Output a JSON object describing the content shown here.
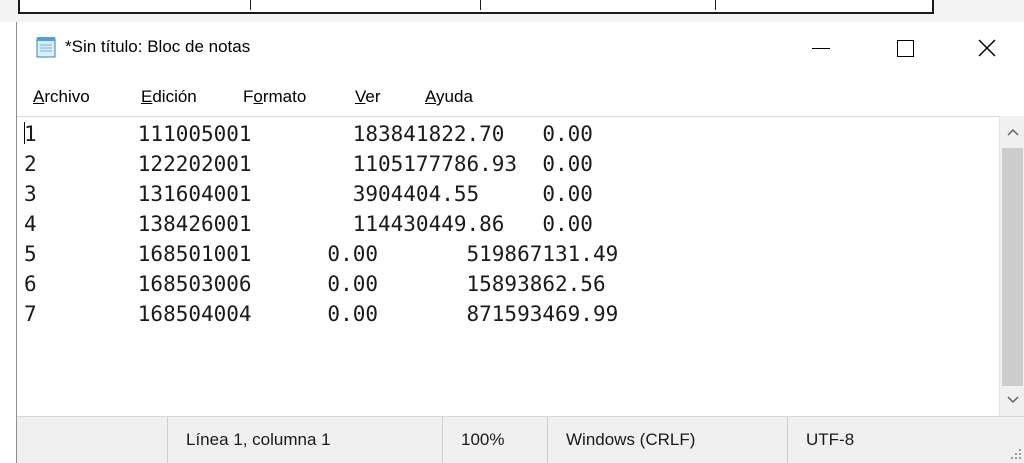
{
  "window": {
    "title": "*Sin título: Bloc de notas"
  },
  "menu": {
    "items": [
      {
        "label_ul": "A",
        "label_rest": "rchivo"
      },
      {
        "label_ul": "E",
        "label_rest": "dición"
      },
      {
        "label_pre": "F",
        "label_ul": "o",
        "label_rest": "rmato"
      },
      {
        "label_ul": "V",
        "label_rest": "er"
      },
      {
        "label_ul": "A",
        "label_rest": "yuda"
      }
    ]
  },
  "editor": {
    "lines": [
      "1        111005001        183841822.70   0.00",
      "2        122202001        1105177786.93  0.00",
      "3        131604001        3904404.55     0.00",
      "4        138426001        114430449.86   0.00",
      "5        168501001      0.00       519867131.49",
      "6        168503006      0.00       15893862.56",
      "7        168504004      0.00       871593469.99"
    ]
  },
  "status": {
    "position": "Línea 1, columna 1",
    "zoom": "100%",
    "line_endings": "Windows (CRLF)",
    "encoding": "UTF-8"
  },
  "icons": {
    "app": "notepad-icon",
    "minimize": "minimize-icon",
    "maximize": "maximize-icon",
    "close": "close-icon",
    "scroll_up": "chevron-up-icon",
    "scroll_down": "chevron-down-icon",
    "resize": "resize-grip-icon"
  }
}
